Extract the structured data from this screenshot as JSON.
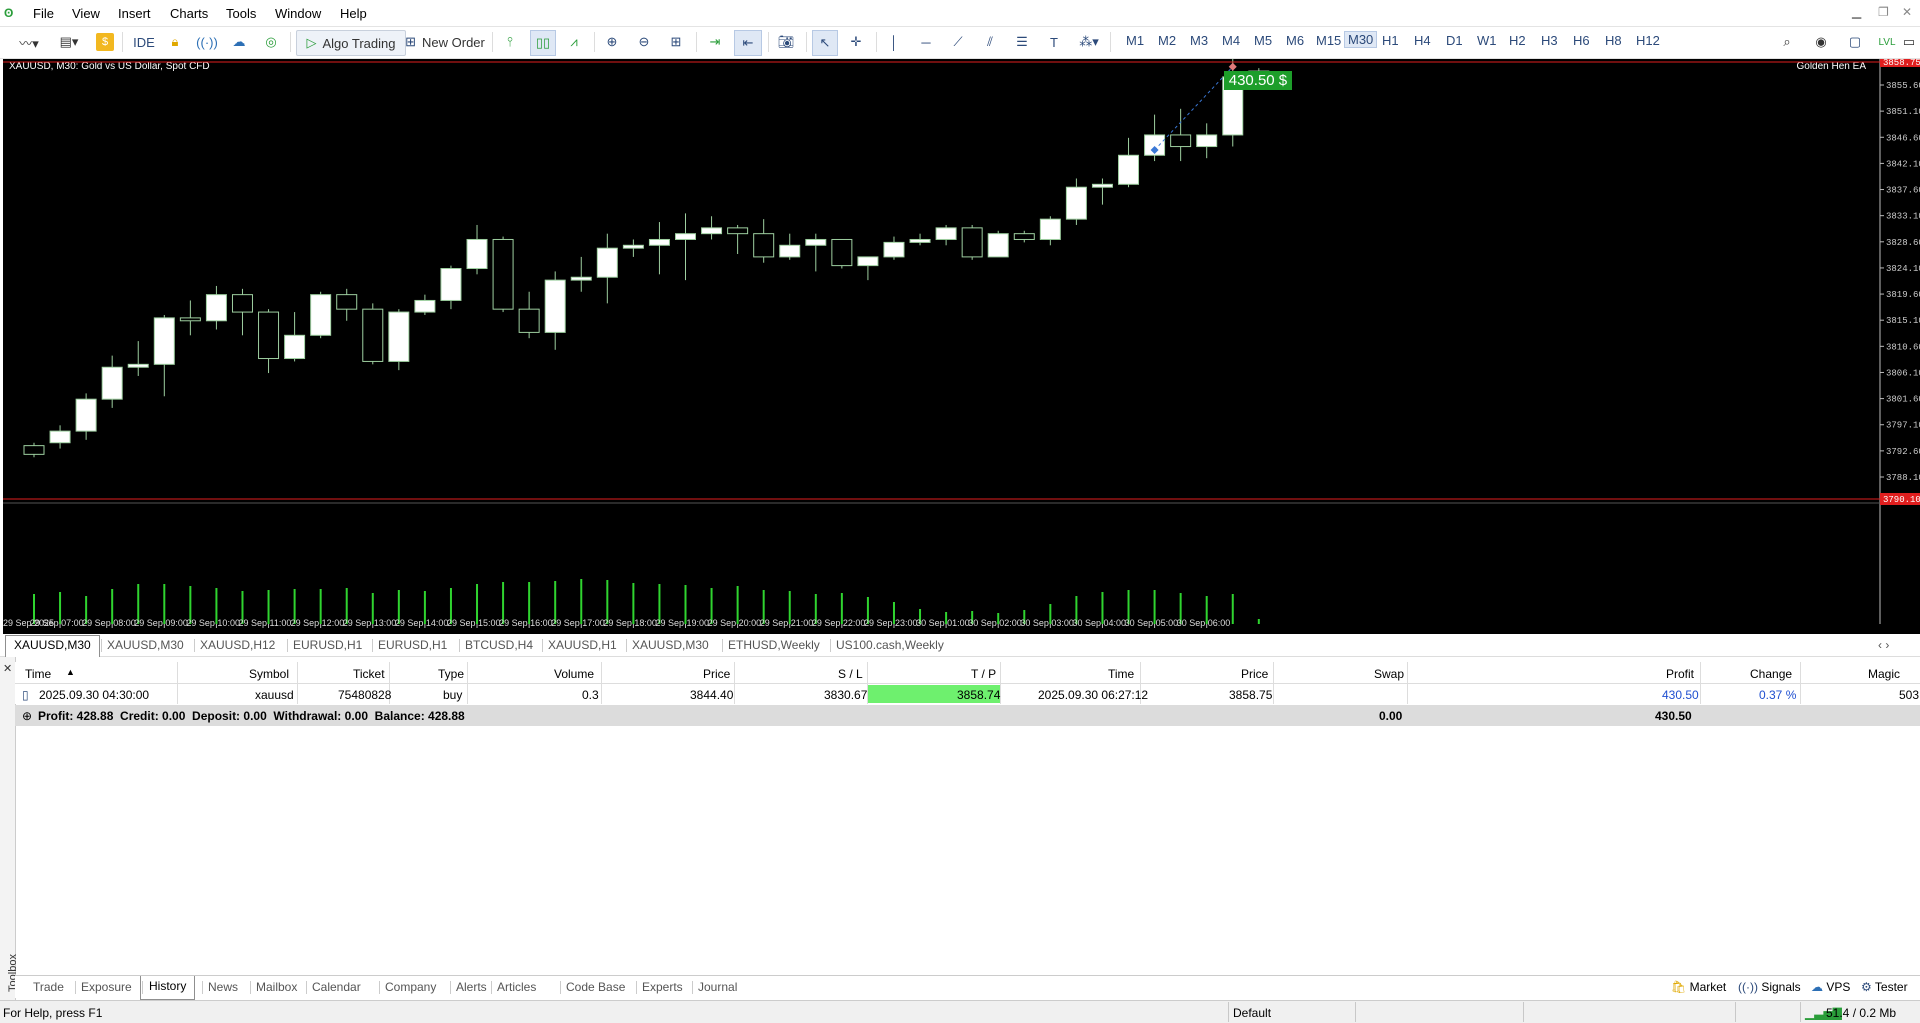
{
  "menu": {
    "items": [
      "File",
      "View",
      "Insert",
      "Charts",
      "Tools",
      "Window",
      "Help"
    ]
  },
  "toolbar": {
    "ide_label": "IDE",
    "algo_label": "Algo Trading",
    "new_order_label": "New Order",
    "timeframes": [
      "M1",
      "M2",
      "M3",
      "M4",
      "M5",
      "M6",
      "M15",
      "M30",
      "H1",
      "H4",
      "D1",
      "W1",
      "H2",
      "H3",
      "H6",
      "H8",
      "H12"
    ],
    "active_timeframe": "M30"
  },
  "chart": {
    "title": "XAUUSD, M30:  Gold vs US Dollar, Spot CFD",
    "ea_label": "Golden Hen EA",
    "profit_tag": "430.50 $",
    "price_labels": [
      "3855.60",
      "3851.10",
      "3846.60",
      "3842.10",
      "3837.60",
      "3833.10",
      "3828.60",
      "3824.10",
      "3819.60",
      "3815.10",
      "3810.60",
      "3806.10",
      "3801.60",
      "3797.10",
      "3792.60",
      "3788.10"
    ],
    "time_labels": [
      "29 Sep 2025",
      "29 Sep 07:00",
      "29 Sep 08:00",
      "29 Sep 09:00",
      "29 Sep 10:00",
      "29 Sep 11:00",
      "29 Sep 12:00",
      "29 Sep 13:00",
      "29 Sep 14:00",
      "29 Sep 15:00",
      "29 Sep 16:00",
      "29 Sep 17:00",
      "29 Sep 18:00",
      "29 Sep 19:00",
      "29 Sep 20:00",
      "29 Sep 21:00",
      "29 Sep 22:00",
      "29 Sep 23:00",
      "30 Sep 01:00",
      "30 Sep 02:00",
      "30 Sep 03:00",
      "30 Sep 04:00",
      "30 Sep 05:00",
      "30 Sep 06:00"
    ],
    "candles": [
      [
        3793.5,
        3794.0,
        3792.0,
        3791.5
      ],
      [
        3794.0,
        3797.0,
        3796.0,
        3793.0
      ],
      [
        3796.0,
        3802.5,
        3801.5,
        3794.5
      ],
      [
        3801.5,
        3809.0,
        3807.0,
        3800.0
      ],
      [
        3807.0,
        3811.5,
        3807.5,
        3805.5
      ],
      [
        3807.5,
        3816.0,
        3815.5,
        3802.0
      ],
      [
        3815.5,
        3818.5,
        3815.0,
        3812.5
      ],
      [
        3815.0,
        3821.0,
        3819.5,
        3813.5
      ],
      [
        3819.5,
        3820.5,
        3816.5,
        3812.5
      ],
      [
        3816.5,
        3817.0,
        3808.5,
        3806.0
      ],
      [
        3808.5,
        3816.5,
        3812.5,
        3808.0
      ],
      [
        3812.5,
        3820.0,
        3819.5,
        3812.0
      ],
      [
        3819.5,
        3820.5,
        3817.0,
        3815.0
      ],
      [
        3817.0,
        3818.0,
        3808.0,
        3807.5
      ],
      [
        3808.0,
        3817.0,
        3816.5,
        3806.5
      ],
      [
        3816.5,
        3819.5,
        3818.5,
        3816.0
      ],
      [
        3818.5,
        3824.5,
        3824.0,
        3817.0
      ],
      [
        3824.0,
        3831.5,
        3829.0,
        3823.0
      ],
      [
        3829.0,
        3829.5,
        3817.0,
        3816.5
      ],
      [
        3817.0,
        3820.0,
        3813.0,
        3812.0
      ],
      [
        3813.0,
        3823.5,
        3822.0,
        3810.0
      ],
      [
        3822.0,
        3826.0,
        3822.5,
        3820.0
      ],
      [
        3822.5,
        3830.0,
        3827.5,
        3818.0
      ],
      [
        3827.5,
        3829.0,
        3828.0,
        3826.0
      ],
      [
        3828.0,
        3832.0,
        3829.0,
        3823.0
      ],
      [
        3829.0,
        3833.5,
        3830.0,
        3822.0
      ],
      [
        3830.0,
        3833.0,
        3831.0,
        3829.0
      ],
      [
        3831.0,
        3831.5,
        3830.0,
        3826.5
      ],
      [
        3830.0,
        3832.5,
        3826.0,
        3825.0
      ],
      [
        3826.0,
        3830.0,
        3828.0,
        3825.5
      ],
      [
        3828.0,
        3830.0,
        3829.0,
        3823.5
      ],
      [
        3829.0,
        3828.5,
        3824.5,
        3824.0
      ],
      [
        3824.5,
        3825.5,
        3826.0,
        3822.0
      ],
      [
        3826.0,
        3829.5,
        3828.5,
        3825.5
      ],
      [
        3828.5,
        3830.0,
        3829.0,
        3828.0
      ],
      [
        3829.0,
        3831.5,
        3831.0,
        3828.0
      ],
      [
        3831.0,
        3831.5,
        3826.0,
        3825.5
      ],
      [
        3826.0,
        3830.5,
        3830.0,
        3826.0
      ],
      [
        3830.0,
        3830.5,
        3829.0,
        3828.5
      ],
      [
        3829.0,
        3833.0,
        3832.5,
        3828.0
      ],
      [
        3832.5,
        3839.5,
        3838.0,
        3831.5
      ],
      [
        3838.0,
        3839.5,
        3838.5,
        3835.0
      ],
      [
        3838.5,
        3846.5,
        3843.5,
        3838.0
      ],
      [
        3843.5,
        3850.5,
        3847.0,
        3842.5
      ],
      [
        3847.0,
        3851.5,
        3845.0,
        3842.5
      ],
      [
        3845.0,
        3849.0,
        3847.0,
        3843.0
      ],
      [
        3847.0,
        3867.0,
        3857.0,
        3845.0
      ],
      [
        3857.0,
        3858.5,
        3858.0,
        3857.0
      ]
    ],
    "volumes": [
      30,
      32,
      28,
      35,
      40,
      40,
      38,
      36,
      33,
      34,
      35,
      35,
      36,
      31,
      34,
      33,
      36,
      40,
      42,
      42,
      43,
      45,
      44,
      41,
      40,
      39,
      36,
      38,
      34,
      33,
      30,
      31,
      27,
      22,
      15,
      12,
      13,
      11,
      14,
      20,
      28,
      32,
      34,
      34,
      31,
      28,
      30,
      5
    ],
    "price_line": "3858.75",
    "bottom_line": "3790.10"
  },
  "chart_tabs": [
    "XAUUSD,M30",
    "XAUUSD,M30",
    "XAUUSD,H12",
    "EURUSD,H1",
    "EURUSD,H1",
    "BTCUSD,H4",
    "XAUUSD,H1",
    "XAUUSD,M30",
    "ETHUSD,Weekly",
    "US100.cash,Weekly"
  ],
  "table": {
    "headers": [
      "Time",
      "Symbol",
      "Ticket",
      "Type",
      "Volume",
      "Price",
      "S / L",
      "T / P",
      "Time",
      "Price",
      "Swap",
      "Profit",
      "Change",
      "Magic"
    ],
    "row": {
      "time_open": "2025.09.30 04:30:00",
      "symbol": "xauusd",
      "ticket": "75480828",
      "type": "buy",
      "volume": "0.3",
      "price_open": "3844.40",
      "sl": "3830.67",
      "tp": "3858.74",
      "time_close": "2025.09.30 06:27:12",
      "price_close": "3858.75",
      "swap": "",
      "profit": "430.50",
      "change": "0.37 %",
      "magic": "503"
    },
    "summary": {
      "text": "Profit: 428.88  Credit: 0.00  Deposit: 0.00  Withdrawal: 0.00  Balance: 428.88",
      "swap": "0.00",
      "profit": "430.50"
    }
  },
  "toolbox": {
    "label": "Toolbox"
  },
  "bottom_tabs": [
    "Trade",
    "Exposure",
    "History",
    "News",
    "Mailbox",
    "Calendar",
    "Company",
    "Alerts",
    "Articles",
    "Code Base",
    "Experts",
    "Journal"
  ],
  "bottom_right": {
    "market": "Market",
    "signals": "Signals",
    "vps": "VPS",
    "tester": "Tester"
  },
  "status": {
    "help": "For Help, press F1",
    "profile": "Default",
    "net": "51.4 / 0.2 Mb"
  }
}
